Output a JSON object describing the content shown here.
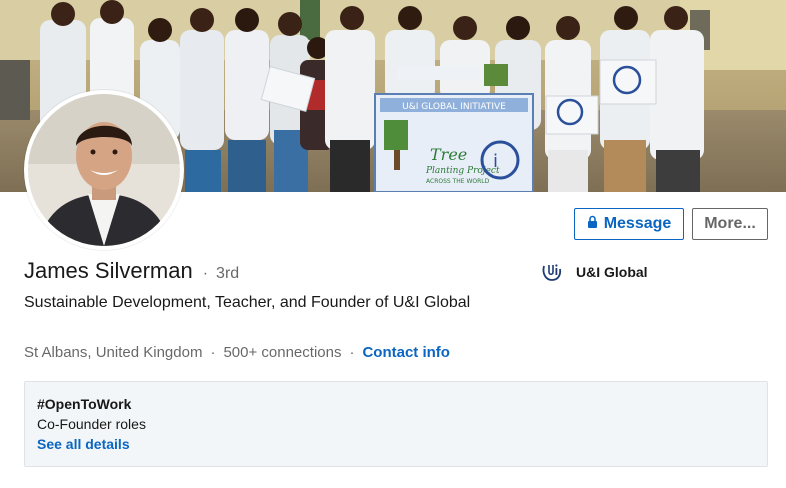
{
  "profile": {
    "name": "James Silverman",
    "connection_degree": "3rd",
    "degree_separator": "·",
    "headline": "Sustainable Development, Teacher, and Founder of U&I Global",
    "location": "St Albans, United Kingdom",
    "connections": "500+ connections",
    "contact_label": "Contact info",
    "meta_separator": "·"
  },
  "actions": {
    "message_label": "Message",
    "more_label": "More..."
  },
  "company": {
    "name": "U&I Global"
  },
  "open_to_work": {
    "title": "#OpenToWork",
    "roles": "Co-Founder roles",
    "link_label": "See all details"
  },
  "banner": {
    "sign_lines": [
      "U&I GLOBAL INITIATIVE",
      "Tree",
      "Planting Project",
      "ACROSS THE WORLD"
    ]
  },
  "colors": {
    "accent": "#0a66c2",
    "card_bg": "#f3f6f8"
  },
  "icons": {
    "lock": "lock-icon",
    "company_logo": "ui-global-logo-icon"
  }
}
